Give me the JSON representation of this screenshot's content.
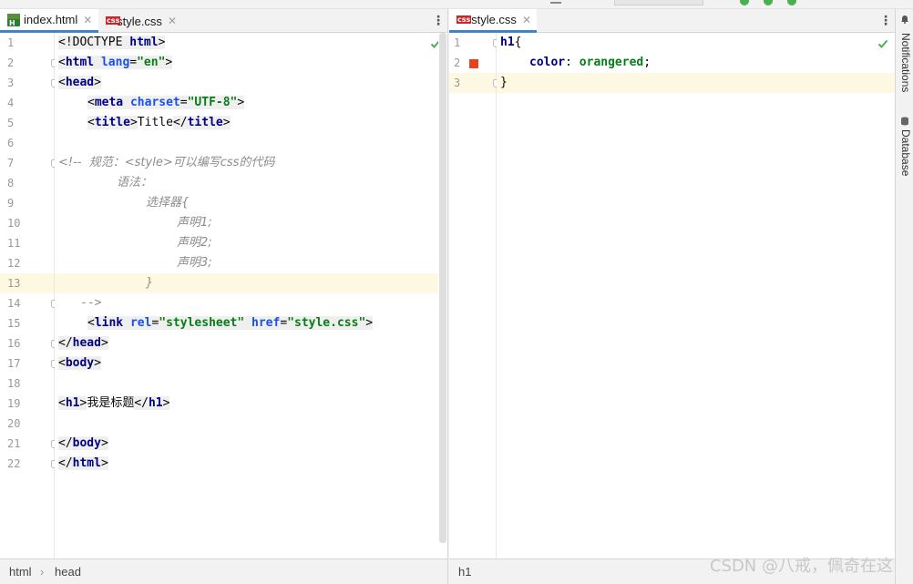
{
  "left_editor": {
    "tabs": [
      {
        "label": "index.html",
        "icon": "html-file-icon",
        "active": true
      },
      {
        "label": "style.css",
        "icon": "css-file-icon",
        "active": false
      }
    ],
    "line_numbers": [
      "1",
      "2",
      "3",
      "4",
      "5",
      "6",
      "7",
      "8",
      "9",
      "10",
      "11",
      "12",
      "13",
      "14",
      "15",
      "16",
      "17",
      "18",
      "19",
      "20",
      "21",
      "22"
    ],
    "code": {
      "l1_a": "<!DOCTYPE ",
      "l1_b": "html",
      "l1_c": ">",
      "l2_tag_open": "<",
      "l2_tag": "html",
      "l2_attr": " lang",
      "l2_eq": "=",
      "l2_val": "\"en\"",
      "l2_close": ">",
      "l3_open": "<",
      "l3_tag": "head",
      "l3_close": ">",
      "l4_open": "<",
      "l4_tag": "meta",
      "l4_attr": " charset",
      "l4_eq": "=",
      "l4_val": "\"UTF-8\"",
      "l4_close": ">",
      "l5_open": "<",
      "l5_tag": "title",
      "l5_mid": ">",
      "l5_text": "Title",
      "l5_end_open": "</",
      "l5_end_tag": "title",
      "l5_end_close": ">",
      "l7": "<!--  规范：<style>可以编写css的代码",
      "l8": "语法：",
      "l9": "选择器{",
      "l10": "声明1;",
      "l11": "声明2;",
      "l12": "声明3;",
      "l13": "}",
      "l14": "-->",
      "l15_open": "<",
      "l15_tag": "link",
      "l15_attr1": " rel",
      "l15_eq1": "=",
      "l15_val1": "\"stylesheet\"",
      "l15_attr2": " href",
      "l15_eq2": "=",
      "l15_val2": "\"style.css\"",
      "l15_close": ">",
      "l16_open": "</",
      "l16_tag": "head",
      "l16_close": ">",
      "l17_open": "<",
      "l17_tag": "body",
      "l17_close": ">",
      "l19_open": "<",
      "l19_tag": "h1",
      "l19_mid": ">",
      "l19_text": "我是标题",
      "l19_end_open": "</",
      "l19_end_tag": "h1",
      "l19_end_close": ">",
      "l21_open": "</",
      "l21_tag": "body",
      "l21_close": ">",
      "l22_open": "</",
      "l22_tag": "html",
      "l22_close": ">"
    },
    "breadcrumbs": [
      "html",
      "head"
    ]
  },
  "right_editor": {
    "tabs": [
      {
        "label": "style.css",
        "icon": "css-file-icon",
        "active": true
      }
    ],
    "line_numbers": [
      "1",
      "2",
      "3"
    ],
    "code": {
      "l1_sel": "h1",
      "l1_brace": "{",
      "l2_prop": "color",
      "l2_colon": ": ",
      "l2_val": "orangered",
      "l2_semi": ";",
      "l3": "}"
    },
    "breadcrumbs": [
      "h1"
    ],
    "color_swatch": "#ff4500"
  },
  "right_sidebar": {
    "notifications_label": "Notifications",
    "database_label": "Database"
  },
  "watermark": "CSDN @八戒，佩奇在这",
  "colors": {
    "tag": "#000080",
    "attribute": "#1750eb",
    "string": "#067d17",
    "comment": "#8c8c8c",
    "active_tab_underline": "#4083c9",
    "current_line": "#fdf8e1"
  }
}
